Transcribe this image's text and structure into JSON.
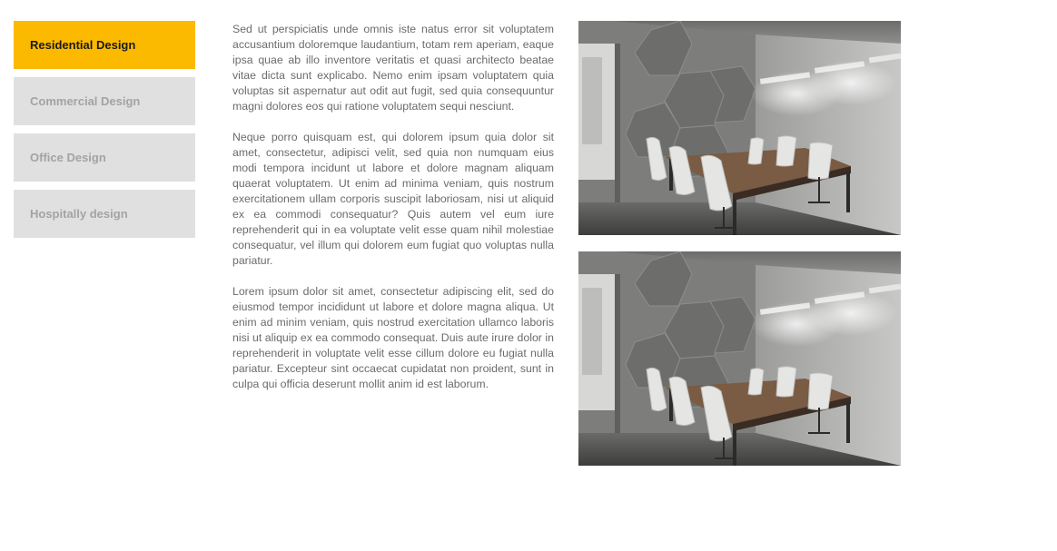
{
  "tabs": [
    {
      "label": "Residential Design",
      "active": true
    },
    {
      "label": "Commercial Design",
      "active": false
    },
    {
      "label": "Office Design",
      "active": false
    },
    {
      "label": "Hospitally design",
      "active": false
    }
  ],
  "colors": {
    "accent": "#fbb900",
    "tab_inactive_bg": "#e0e0e0",
    "tab_inactive_text": "#a3a3a3",
    "body_text": "#6b6b6b"
  },
  "content": {
    "paragraphs": [
      "Sed ut perspiciatis unde omnis iste natus error sit voluptatem accusantium doloremque laudantium, totam rem aperiam, eaque ipsa quae ab illo inventore veritatis et quasi architecto beatae vitae dicta sunt explicabo. Nemo enim ipsam voluptatem quia voluptas sit aspernatur aut odit aut fugit, sed quia consequuntur magni dolores eos qui ratione voluptatem sequi nesciunt.",
      "Neque porro quisquam est, qui dolorem ipsum quia dolor sit amet, consectetur, adipisci velit, sed quia non numquam eius modi tempora incidunt ut labore et dolore magnam aliquam quaerat voluptatem. Ut enim ad minima veniam, quis nostrum exercitationem ullam corporis suscipit laboriosam, nisi ut aliquid ex ea commodi consequatur? Quis autem vel eum iure reprehenderit qui in ea voluptate velit esse quam nihil molestiae consequatur, vel illum qui dolorem eum fugiat quo voluptas nulla pariatur.",
      "Lorem ipsum dolor sit amet, consectetur adipiscing elit, sed do eiusmod tempor incididunt ut labore et dolore magna aliqua. Ut enim ad minim veniam, quis nostrud exercitation ullamco laboris nisi ut aliquip ex ea commodo consequat. Duis aute irure dolor in reprehenderit in voluptate velit esse cillum dolore eu fugiat nulla pariatur. Excepteur sint occaecat cupidatat non proident, sunt in culpa qui officia deserunt mollit anim id est laborum."
    ]
  },
  "images": [
    {
      "subject": "conference-room-photo"
    },
    {
      "subject": "conference-room-photo"
    }
  ]
}
